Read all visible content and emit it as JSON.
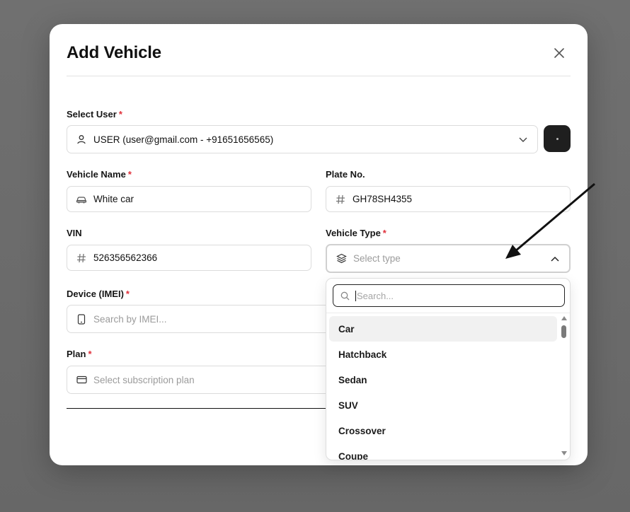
{
  "modal": {
    "title": "Add Vehicle"
  },
  "form": {
    "select_user": {
      "label": "Select User",
      "required_mark": "*",
      "value": "USER (user@gmail.com - +91651656565)",
      "user_icon": "user-icon"
    },
    "vehicle_name": {
      "label": "Vehicle Name",
      "required_mark": "*",
      "value": "White car",
      "icon": "car-icon"
    },
    "plate_no": {
      "label": "Plate No.",
      "value": "GH78SH4355",
      "icon": "hash-icon"
    },
    "vin": {
      "label": "VIN",
      "value": "526356562366",
      "icon": "hash-icon"
    },
    "vehicle_type": {
      "label": "Vehicle Type",
      "required_mark": "*",
      "placeholder": "Select type",
      "icon": "layers-icon"
    },
    "device_imei": {
      "label": "Device (IMEI)",
      "required_mark": "*",
      "placeholder": "Search by IMEI...",
      "icon": "phone-icon"
    },
    "plan": {
      "label": "Plan",
      "required_mark": "*",
      "placeholder": "Select subscription plan",
      "icon": "credit-card-icon"
    }
  },
  "dropdown": {
    "search_placeholder": "Search...",
    "options": [
      "Car",
      "Hatchback",
      "Sedan",
      "SUV",
      "Crossover",
      "Coupe"
    ],
    "highlighted": "Car"
  },
  "colors": {
    "required": "#e0303a",
    "dark_button": "#1f1f1f",
    "overlay": "#6b6b6b"
  }
}
